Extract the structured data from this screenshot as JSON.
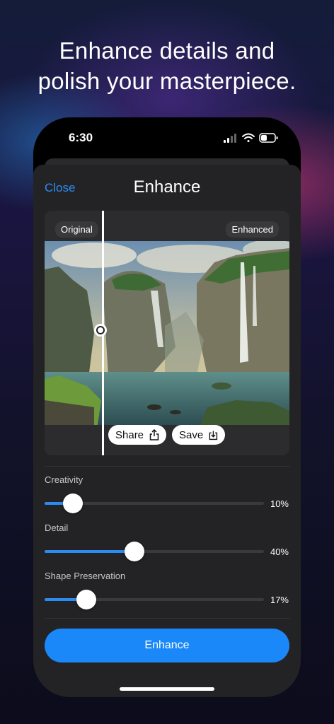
{
  "headline": {
    "line1": "Enhance details and",
    "line2": "polish your masterpiece."
  },
  "status_bar": {
    "time": "6:30"
  },
  "nav": {
    "close_label": "Close",
    "title": "Enhance"
  },
  "compare": {
    "left_tag": "Original",
    "right_tag": "Enhanced",
    "share_label": "Share",
    "save_label": "Save"
  },
  "sliders": [
    {
      "label": "Creativity",
      "value_text": "10%",
      "value": 0.13
    },
    {
      "label": "Detail",
      "value_text": "40%",
      "value": 0.41
    },
    {
      "label": "Shape Preservation",
      "value_text": "17%",
      "value": 0.19
    }
  ],
  "primary_button": {
    "label": "Enhance"
  },
  "colors": {
    "accent": "#2a8bf2",
    "button": "#1a88f8",
    "sheet": "#232325"
  }
}
